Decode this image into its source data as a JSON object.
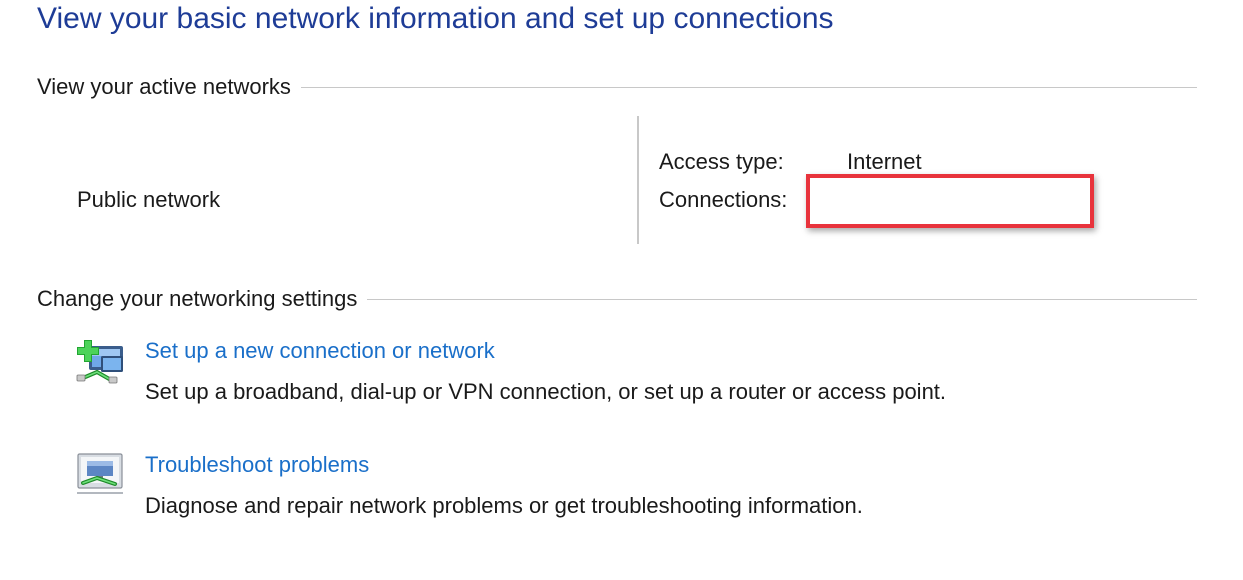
{
  "page": {
    "title": "View your basic network information and set up connections"
  },
  "active_networks": {
    "header": "View your active networks",
    "network_name": "Public network",
    "access_type_label": "Access type:",
    "access_type_value": "Internet",
    "connections_label": "Connections:"
  },
  "settings": {
    "header": "Change your networking settings",
    "tasks": [
      {
        "icon": "new-connection-icon",
        "link": "Set up a new connection or network",
        "description": "Set up a broadband, dial-up or VPN connection, or set up a router or access point."
      },
      {
        "icon": "troubleshoot-icon",
        "link": "Troubleshoot problems",
        "description": "Diagnose and repair network problems or get troubleshooting information."
      }
    ]
  },
  "colors": {
    "title": "#1e3c96",
    "link": "#1a6fc9",
    "highlight_border": "#e8333c",
    "rule": "#c8c8c8"
  }
}
